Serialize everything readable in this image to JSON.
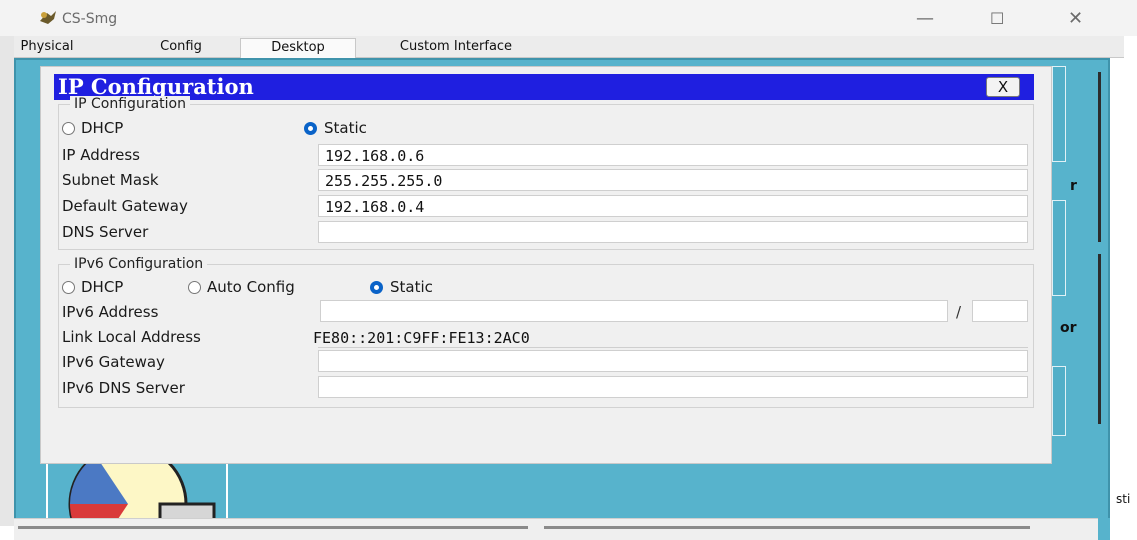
{
  "window": {
    "title": "CS-Smg",
    "icon": "packet-tracer-pc-icon",
    "minimize": "—",
    "maximize": "☐",
    "close": "✕"
  },
  "tabs": [
    {
      "label": "Physical",
      "active": false
    },
    {
      "label": "Config",
      "active": false
    },
    {
      "label": "Desktop",
      "active": true
    },
    {
      "label": "Custom Interface",
      "active": false
    }
  ],
  "dialog": {
    "title": "IP Configuration",
    "close_label": "X",
    "ipv4": {
      "legend": "IP Configuration",
      "dhcp_label": "DHCP",
      "static_label": "Static",
      "selected": "Static",
      "ip_address_label": "IP Address",
      "ip_address": "192.168.0.6",
      "subnet_mask_label": "Subnet Mask",
      "subnet_mask": "255.255.255.0",
      "default_gateway_label": "Default Gateway",
      "default_gateway": "192.168.0.4",
      "dns_server_label": "DNS Server",
      "dns_server": ""
    },
    "ipv6": {
      "legend": "IPv6 Configuration",
      "dhcp_label": "DHCP",
      "auto_config_label": "Auto Config",
      "static_label": "Static",
      "selected": "Static",
      "ipv6_address_label": "IPv6 Address",
      "ipv6_address": "",
      "prefix_separator": "/",
      "prefix_length": "",
      "link_local_label": "Link Local Address",
      "link_local": "FE80::201:C9FF:FE13:2AC0",
      "ipv6_gateway_label": "IPv6 Gateway",
      "ipv6_gateway": "",
      "ipv6_dns_label": "IPv6 DNS Server",
      "ipv6_dns": ""
    }
  },
  "background": {
    "partial_text_1": "r",
    "partial_text_2": "or",
    "partial_text_3": "sti"
  },
  "colors": {
    "desktop_bg": "#57b3cc",
    "dialog_title_bg": "#1f1fe0",
    "radio_selected": "#0a63c8"
  }
}
